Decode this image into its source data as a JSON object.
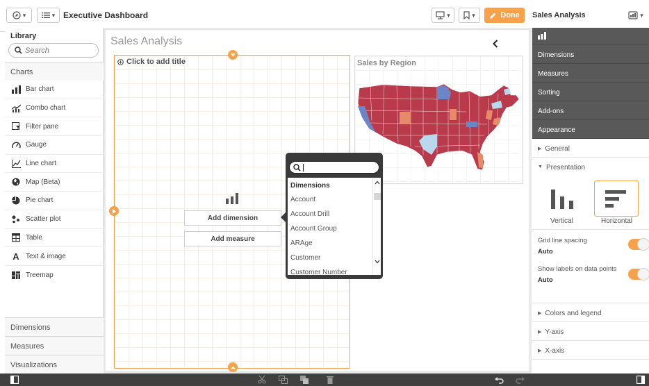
{
  "toolbar": {
    "app_title": "Executive Dashboard",
    "done_label": "Done",
    "sheet_name": "Sales Analysis",
    "icons": [
      "compass-icon",
      "list-icon",
      "presentation-icon",
      "bookmark-icon",
      "pencil-icon",
      "sheet-thumbnail-icon"
    ]
  },
  "library": {
    "title": "Library",
    "search_placeholder": "Search",
    "charts_section": "Charts",
    "charts": [
      {
        "label": "Bar chart",
        "icon": "bar-chart-icon"
      },
      {
        "label": "Combo chart",
        "icon": "combo-chart-icon"
      },
      {
        "label": "Filter pane",
        "icon": "filter-pane-icon"
      },
      {
        "label": "Gauge",
        "icon": "gauge-icon"
      },
      {
        "label": "Line chart",
        "icon": "line-chart-icon"
      },
      {
        "label": "Map (Beta)",
        "icon": "map-icon"
      },
      {
        "label": "Pie chart",
        "icon": "pie-chart-icon"
      },
      {
        "label": "Scatter plot",
        "icon": "scatter-plot-icon"
      },
      {
        "label": "Table",
        "icon": "table-icon"
      },
      {
        "label": "Text & image",
        "icon": "text-image-icon"
      },
      {
        "label": "Treemap",
        "icon": "treemap-icon"
      }
    ],
    "bottom_sections": [
      "Dimensions",
      "Measures",
      "Visualizations"
    ]
  },
  "sheet": {
    "title": "Sales Analysis",
    "placeholder_title": "Click to add title",
    "add_dimension": "Add dimension",
    "add_measure": "Add measure",
    "map_title": "Sales by Region"
  },
  "popup": {
    "search_value": "",
    "header": "Dimensions",
    "items": [
      "Account",
      "Account Drill",
      "Account Group",
      "ARAge",
      "Customer",
      "Customer Number"
    ]
  },
  "properties": {
    "sections": [
      "Dimensions",
      "Measures",
      "Sorting",
      "Add-ons",
      "Appearance"
    ],
    "general": "General",
    "presentation": "Presentation",
    "vertical_label": "Vertical",
    "horizontal_label": "Horizontal",
    "selected_orientation": "Horizontal",
    "grid_spacing_label": "Grid line spacing",
    "grid_spacing_value": "Auto",
    "show_labels_label": "Show labels on data points",
    "show_labels_value": "Auto",
    "collapsed_sections": [
      "Colors and legend",
      "Y-axis",
      "X-axis"
    ]
  },
  "colors": {
    "accent": "#f7a24a",
    "panel_dark": "#595959",
    "map_red": "#b83a4b",
    "map_blue": "#6b86c8",
    "map_light_blue": "#b8d8ee",
    "map_salmon": "#e68a6a"
  }
}
